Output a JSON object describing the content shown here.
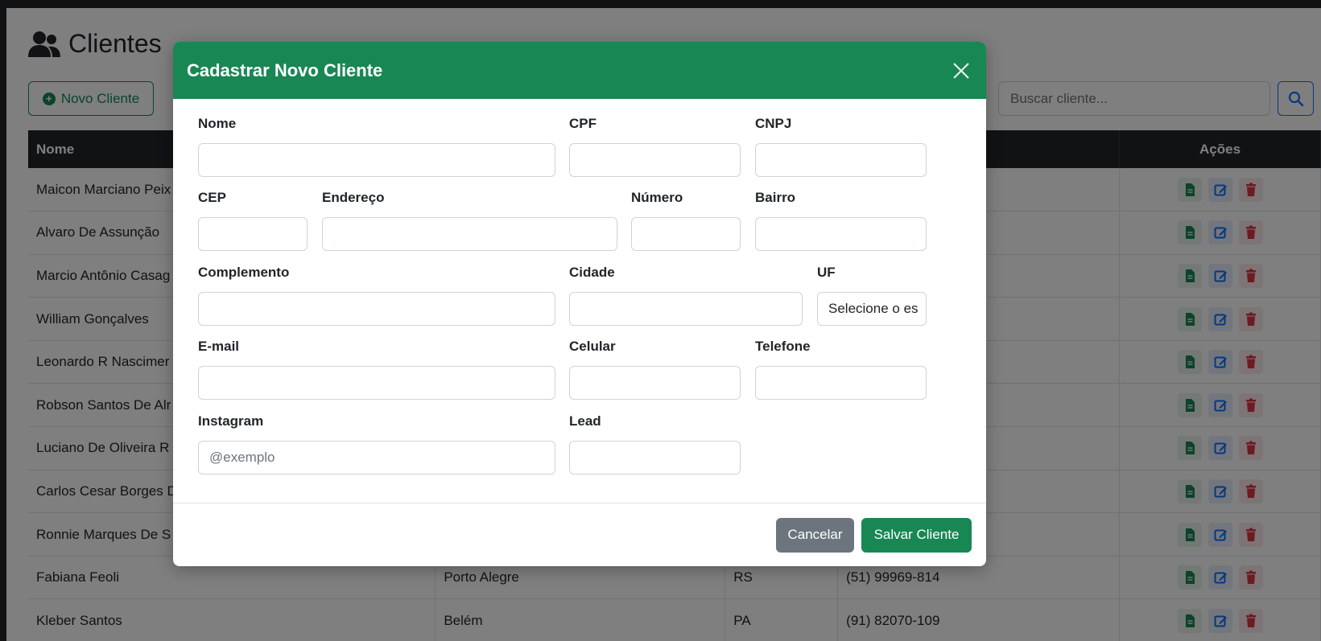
{
  "page": {
    "title": "Clientes",
    "new_client_label": "Novo Cliente",
    "search_placeholder": "Buscar cliente..."
  },
  "table": {
    "headers": {
      "nome": "Nome",
      "acoes": "Ações"
    },
    "rows": [
      {
        "nome": "Maicon Marciano Peix",
        "cidade": "",
        "uf": "",
        "telefone": ""
      },
      {
        "nome": "Alvaro De Assunção",
        "cidade": "",
        "uf": "",
        "telefone": ""
      },
      {
        "nome": "Marcio Antônio Casag",
        "cidade": "",
        "uf": "",
        "telefone": ""
      },
      {
        "nome": "William Gonçalves",
        "cidade": "",
        "uf": "",
        "telefone": ""
      },
      {
        "nome": "Leonardo R Nascimer",
        "cidade": "",
        "uf": "",
        "telefone": ""
      },
      {
        "nome": "Robson Santos De Alr",
        "cidade": "",
        "uf": "",
        "telefone": ""
      },
      {
        "nome": "Luciano De Oliveira R",
        "cidade": "",
        "uf": "",
        "telefone": ""
      },
      {
        "nome": "Carlos Cesar Borges D",
        "cidade": "",
        "uf": "",
        "telefone": ""
      },
      {
        "nome": "Ronnie Marques De S",
        "cidade": "",
        "uf": "",
        "telefone": ""
      },
      {
        "nome": "Fabiana Feoli",
        "cidade": "Porto Alegre",
        "uf": "RS",
        "telefone": "(51) 99969-814"
      },
      {
        "nome": "Kleber Santos",
        "cidade": "Belém",
        "uf": "PA",
        "telefone": "(91) 82070-109"
      }
    ]
  },
  "modal": {
    "title": "Cadastrar Novo Cliente",
    "fields": {
      "nome": {
        "label": "Nome",
        "value": ""
      },
      "cpf": {
        "label": "CPF",
        "value": ""
      },
      "cnpj": {
        "label": "CNPJ",
        "value": ""
      },
      "cep": {
        "label": "CEP",
        "value": ""
      },
      "endereco": {
        "label": "Endereço",
        "value": ""
      },
      "numero": {
        "label": "Número",
        "value": ""
      },
      "bairro": {
        "label": "Bairro",
        "value": ""
      },
      "complemento": {
        "label": "Complemento",
        "value": ""
      },
      "cidade": {
        "label": "Cidade",
        "value": ""
      },
      "uf": {
        "label": "UF",
        "selected": "Selecione o es"
      },
      "email": {
        "label": "E-mail",
        "value": ""
      },
      "celular": {
        "label": "Celular",
        "value": ""
      },
      "telefone": {
        "label": "Telefone",
        "value": ""
      },
      "instagram": {
        "label": "Instagram",
        "placeholder": "@exemplo",
        "value": ""
      },
      "lead": {
        "label": "Lead",
        "value": ""
      }
    },
    "cancel_label": "Cancelar",
    "save_label": "Salvar Cliente"
  },
  "colors": {
    "primary_green": "#198754",
    "table_header": "#212529",
    "secondary": "#6c757d",
    "danger": "#dc3545",
    "primary_blue": "#0d6efd"
  }
}
